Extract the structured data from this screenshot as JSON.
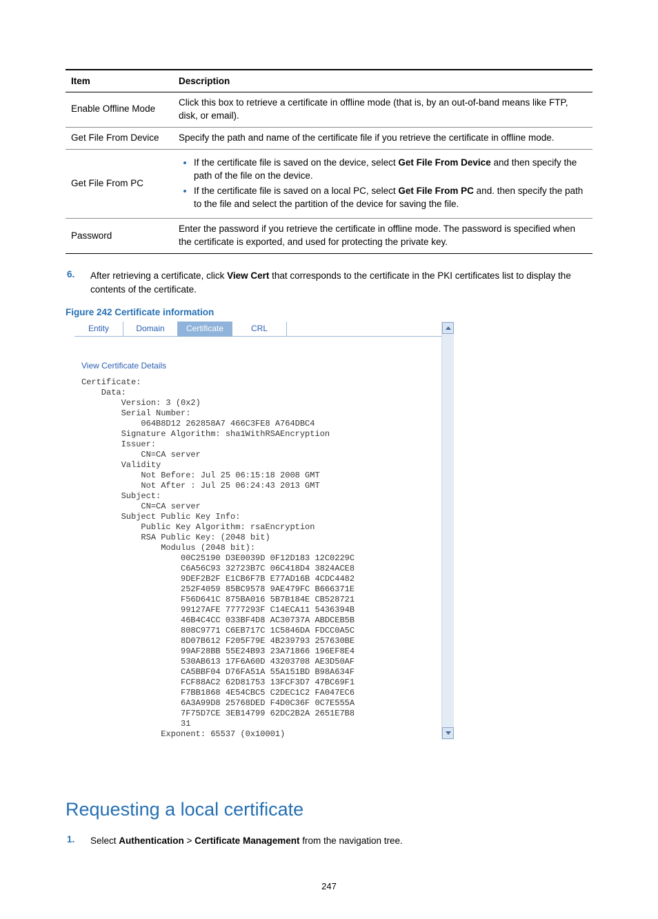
{
  "table": {
    "head": {
      "item": "Item",
      "desc": "Description"
    },
    "rows": [
      {
        "item": "Enable Offline Mode",
        "desc": "Click this box to retrieve a certificate in offline mode (that is, by an out-of-band means like FTP, disk, or email)."
      },
      {
        "item": "Get File From Device",
        "desc": "Specify the path and name of the certificate file if you retrieve the certificate in offline mode."
      },
      {
        "item": "Get File From PC",
        "bullets": [
          {
            "pre": "If the certificate file is saved on the device, select ",
            "bold": "Get File From Device",
            "post": " and then specify the path of the file on the device."
          },
          {
            "pre": "If the certificate file is saved on a local PC, select ",
            "bold": "Get File From PC",
            "post": " and. then specify the path to the file and select the partition of the device for saving the file."
          }
        ]
      },
      {
        "item": "Password",
        "desc": "Enter the password if you retrieve the certificate in offline mode. The password is specified when the certificate is exported, and used for protecting the private key."
      }
    ]
  },
  "step6": {
    "num": "6.",
    "a": "After retrieving a certificate, click ",
    "bold": "View Cert",
    "b": " that corresponds to the certificate in the PKI certificates list to display the contents of the certificate."
  },
  "figCaption": "Figure 242 Certificate information",
  "tabs": {
    "t1": "Entity",
    "t2": "Domain",
    "t3": "Certificate",
    "t4": "CRL"
  },
  "vcd": "View Certificate Details",
  "cert": "Certificate:\n    Data:\n        Version: 3 (0x2)\n        Serial Number:\n            064B8D12 262858A7 466C3FE8 A764DBC4\n        Signature Algorithm: sha1WithRSAEncryption\n        Issuer:\n            CN=CA server\n        Validity\n            Not Before: Jul 25 06:15:18 2008 GMT\n            Not After : Jul 25 06:24:43 2013 GMT\n        Subject:\n            CN=CA server\n        Subject Public Key Info:\n            Public Key Algorithm: rsaEncryption\n            RSA Public Key: (2048 bit)\n                Modulus (2048 bit):\n                    00C25190 D3E0039D 0F12D183 12C0229C\n                    C6A56C93 32723B7C 06C418D4 3824ACE8\n                    9DEF2B2F E1CB6F7B E77AD16B 4CDC4482\n                    252F4059 85BC9578 9AE479FC B666371E\n                    F56D641C 875BA016 5B7B184E CB528721\n                    99127AFE 7777293F C14ECA11 5436394B\n                    46B4C4CC 033BF4D8 AC30737A ABDCEB5B\n                    808C9771 C6EB717C 1C5846DA FDCC0A5C\n                    8D07B612 F205F79E 4B239793 257630BE\n                    99AF28BB 55E24B93 23A71866 196EF8E4\n                    530AB613 17F6A60D 43203708 AE3D50AF\n                    CA5BBF04 D76FA51A 55A151BD B98A634F\n                    FCF88AC2 62D81753 13FCF3D7 47BC69F1\n                    F7BB1868 4E54CBC5 C2DEC1C2 FA047EC6\n                    6A3A99D8 25768DED F4D0C36F 0C7E555A\n                    7F75D7CE 3EB14799 62DC2B2A 2651E7B8\n                    31\n                Exponent: 65537 (0x10001)",
  "heading": "Requesting a local certificate",
  "step1": {
    "num": "1.",
    "a": "Select ",
    "b1": "Authentication",
    "gt": " > ",
    "b2": "Certificate Management",
    "c": " from the navigation tree."
  },
  "pageNum": "247"
}
